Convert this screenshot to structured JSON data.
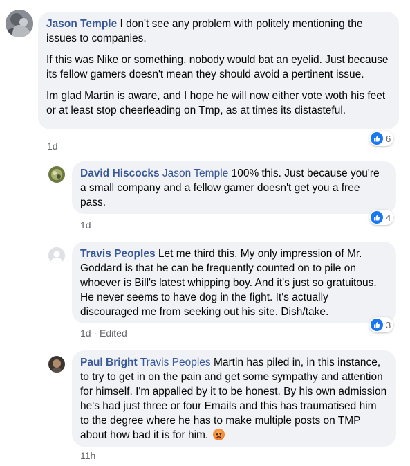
{
  "comments": [
    {
      "author": "Jason Temple",
      "mention": "",
      "paragraphs": [
        "I don't see any problem with politely mentioning the issues to companies.",
        "If this was Nike or something, nobody would bat an eyelid. Just because its fellow gamers doesn't mean they should avoid a pertinent issue.",
        "Im glad Martin is aware, and I hope he will now either vote woth his feet or at least stop cheerleading on Tmp, as at times its distasteful."
      ],
      "time": "1d",
      "edited": "",
      "reaction_count": "6",
      "avatar_icon": "user-avatar-photo"
    },
    {
      "author": "David Hiscocks",
      "mention": "Jason Temple",
      "text": "100% this. Just because you're a small company and a fellow gamer doesn't get you a free pass.",
      "time": "1d",
      "edited": "",
      "reaction_count": "4",
      "avatar_icon": "user-avatar-photo"
    },
    {
      "author": "Travis Peoples",
      "mention": "",
      "text": "Let me third this. My only impression of Mr. Goddard is that he can be frequently counted on to pile on whoever is Bill's latest whipping boy. And it's just so gratuitous. He never seems to have dog in the fight. It's actually discouraged me from seeking out his site. Dish/take.",
      "time": "1d",
      "edited": "Edited",
      "reaction_count": "3",
      "avatar_icon": "default-user-avatar"
    },
    {
      "author": "Paul Bright",
      "mention": "Travis Peoples",
      "text": "Martin has piled in, in this instance, to try to get in on the pain and get some sympathy and attention for himself. I'm appalled by it to be honest. By his own admission he's had just three or four Emails and this has traumatised him to the degree where he has to make multiple posts on TMP about how bad it is for him.",
      "emoji": "angry-face-emoji",
      "time": "11h",
      "edited": "",
      "reaction_count": "",
      "avatar_icon": "user-avatar-photo"
    }
  ],
  "separator": "·",
  "reaction_icon": "like-icon",
  "colors": {
    "bubble": "#f0f2f5",
    "name": "#385898",
    "meta": "#65676b",
    "like": "#1877f2"
  }
}
